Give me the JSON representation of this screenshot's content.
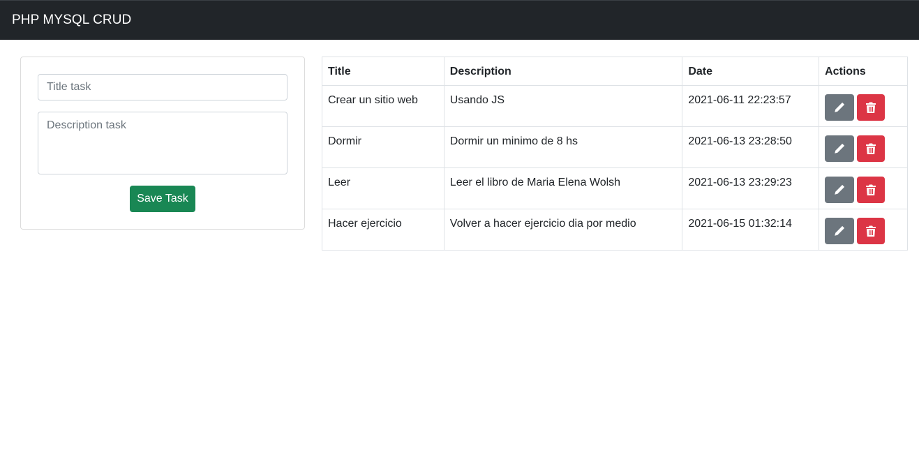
{
  "navbar": {
    "brand": "PHP MYSQL CRUD"
  },
  "form": {
    "title_placeholder": "Title task",
    "title_value": "",
    "description_placeholder": "Description task",
    "description_value": "",
    "save_label": "Save Task"
  },
  "table": {
    "headers": {
      "title": "Title",
      "description": "Description",
      "date": "Date",
      "actions": "Actions"
    },
    "rows": [
      {
        "title": "Crear un sitio web",
        "description": "Usando JS",
        "date": "2021-06-11 22:23:57"
      },
      {
        "title": "Dormir",
        "description": "Dormir un minimo de 8 hs",
        "date": "2021-06-13 23:28:50"
      },
      {
        "title": "Leer",
        "description": "Leer el libro de Maria Elena Wolsh",
        "date": "2021-06-13 23:29:23"
      },
      {
        "title": "Hacer ejercicio",
        "description": "Volver a hacer ejercicio dia por medio",
        "date": "2021-06-15 01:32:14"
      }
    ]
  },
  "icons": {
    "edit": "pencil-icon",
    "delete": "trash-icon"
  },
  "colors": {
    "navbar_bg": "#212529",
    "save_button": "#198754",
    "edit_button": "#6c757d",
    "delete_button": "#dc3545"
  }
}
